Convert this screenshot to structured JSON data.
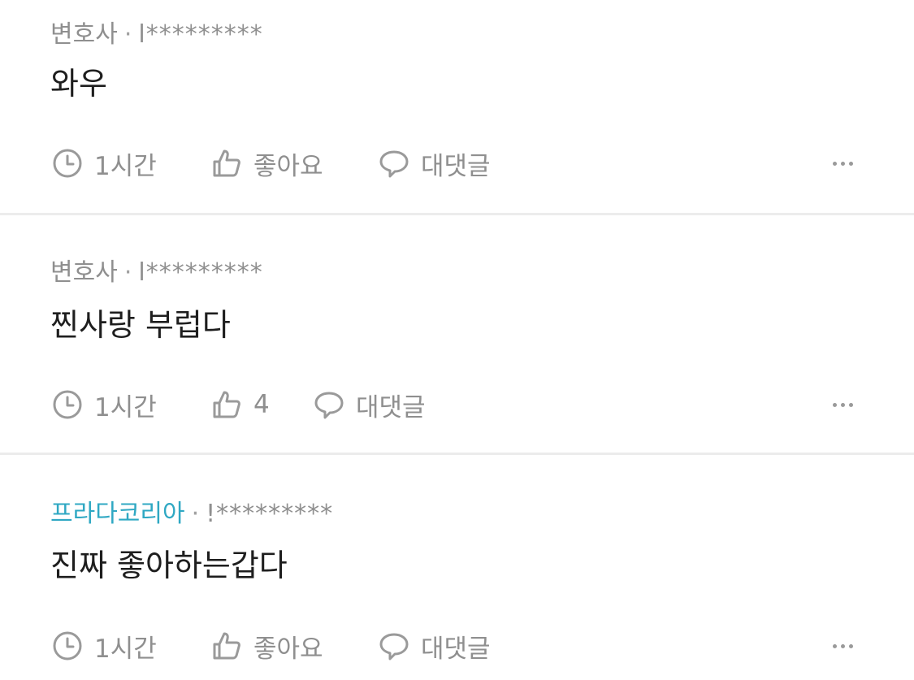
{
  "comments": [
    {
      "author": "변호사",
      "separator": "·",
      "user_id": "l*********",
      "text": "와우",
      "time": "1시간",
      "like_label": "좋아요",
      "reply_label": "대댓글"
    },
    {
      "author": "변호사",
      "separator": "·",
      "user_id": "l*********",
      "text": "찐사랑 부럽다",
      "time": "1시간",
      "like_label": "4",
      "reply_label": "대댓글"
    },
    {
      "author": "프라다코리아",
      "separator": "·",
      "user_id": "!*********",
      "text": "진짜 좋아하는갑다",
      "time": "1시간",
      "like_label": "좋아요",
      "reply_label": "대댓글"
    }
  ],
  "colors": {
    "highlight_author": "#2fa8c3",
    "meta_text": "#8f8f8f",
    "body_text": "#1e1e1e",
    "divider": "#ececec"
  },
  "icons": {
    "time": "clock-icon",
    "like": "thumbs-up-icon",
    "reply": "speech-bubble-icon",
    "more": "more-icon"
  }
}
